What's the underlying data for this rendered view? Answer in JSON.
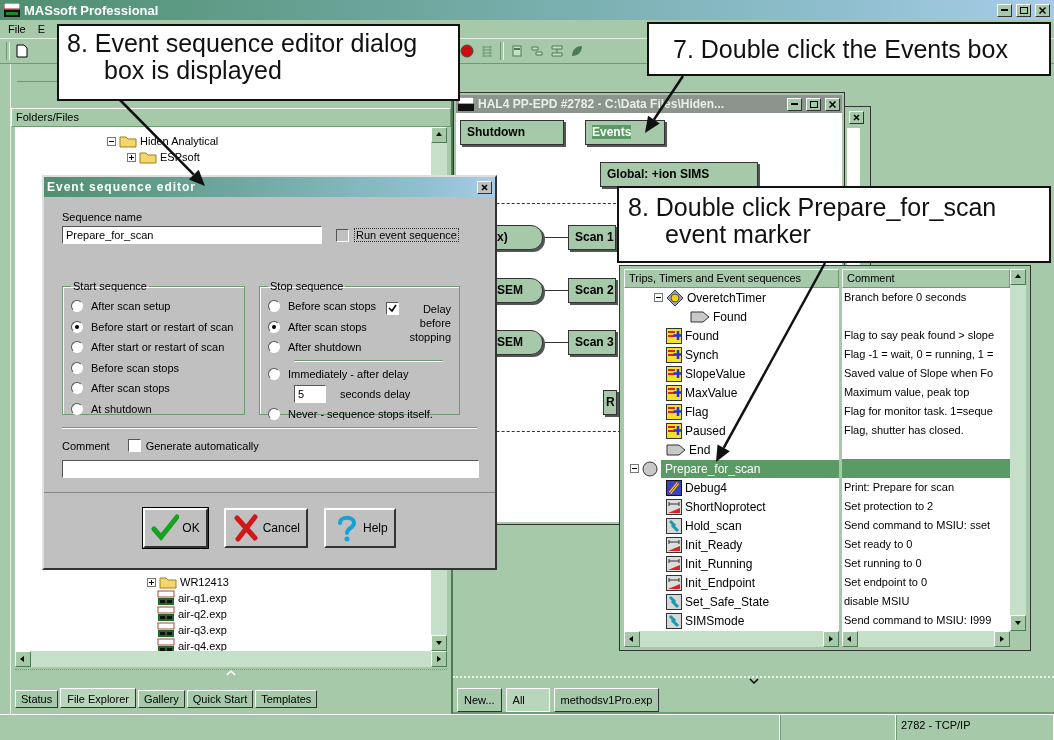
{
  "window": {
    "title": "MASsoft Professional"
  },
  "menu": [
    "File",
    "E"
  ],
  "explorer": {
    "header": "Folders/Files",
    "tree_top": [
      {
        "name": "Hiden Analytical",
        "kind": "folder",
        "expanded": true,
        "children": [
          {
            "name": "ESPsoft",
            "kind": "folder",
            "expanded": false
          }
        ]
      }
    ],
    "tree_bottom": [
      {
        "name": "WR12413",
        "kind": "folder",
        "expanded": false
      },
      {
        "name": "air-q1.exp",
        "kind": "file"
      },
      {
        "name": "air-q2.exp",
        "kind": "file"
      },
      {
        "name": "air-q3.exp",
        "kind": "file"
      },
      {
        "name": "air-q4.exp",
        "kind": "file"
      }
    ],
    "tabs": [
      {
        "label": "Status",
        "selected": false
      },
      {
        "label": "File Explorer",
        "selected": true
      },
      {
        "label": "Gallery",
        "selected": false
      },
      {
        "label": "Quick Start",
        "selected": false
      },
      {
        "label": "Templates",
        "selected": false
      }
    ]
  },
  "method_window": {
    "title": "HAL4 PP-EPD  #2782 - C:\\Data Files\\Hiden...",
    "nodes": [
      {
        "label": "Shutdown",
        "kind": "box",
        "selected": false
      },
      {
        "label": "Events",
        "kind": "box",
        "selected": true
      },
      {
        "label": "Global: +ion SIMS",
        "kind": "box",
        "selected": false
      },
      {
        "label": "x)",
        "kind": "rounded",
        "selected": false
      },
      {
        "label": "Scan 1",
        "kind": "box",
        "selected": false
      },
      {
        "label": "SEM",
        "kind": "rounded",
        "selected": false
      },
      {
        "label": "Scan 2",
        "kind": "box",
        "selected": false
      },
      {
        "label": "SEM",
        "kind": "rounded",
        "selected": false
      },
      {
        "label": "Scan 3",
        "kind": "box",
        "selected": false
      },
      {
        "label": "R",
        "kind": "box",
        "selected": false
      }
    ]
  },
  "trips": {
    "columns": [
      "Trips, Timers and Event sequences",
      "Comment"
    ],
    "partial_children": [
      {
        "name": "OveretchTimer",
        "kind": "timer",
        "comment": "Branch before  0 seconds",
        "selected": false,
        "expanded": true,
        "children": [
          {
            "name": "Found",
            "kind": "marker",
            "selected": false
          }
        ]
      },
      {
        "name": "Found",
        "kind": "variable",
        "comment": "Flag to say peak found > slope",
        "selected": false
      },
      {
        "name": "Synch",
        "kind": "variable",
        "comment": "Flag  -1 = wait, 0 = running, 1 =",
        "selected": false
      },
      {
        "name": "SlopeValue",
        "kind": "variable",
        "comment": "Saved value of Slope when Fo",
        "selected": false
      },
      {
        "name": "MaxValue",
        "kind": "variable",
        "comment": "Maximum value, peak top",
        "selected": false
      },
      {
        "name": "Flag",
        "kind": "variable",
        "comment": "Flag for monitor task. 1=seque",
        "selected": false
      },
      {
        "name": "Paused",
        "kind": "variable",
        "comment": "Flag, shutter has closed.",
        "selected": false
      },
      {
        "name": "End",
        "kind": "marker",
        "selected": false
      }
    ],
    "items": [
      {
        "name": "Prepare_for_scan",
        "kind": "sequence",
        "selected": true,
        "expanded": true,
        "children": [
          {
            "name": "Debug4",
            "kind": "print",
            "comment": "Print: Prepare for scan",
            "selected": false
          },
          {
            "name": "ShortNoprotect",
            "kind": "setting",
            "comment": "Set protection to 2",
            "selected": false
          },
          {
            "name": "Hold_scan",
            "kind": "command",
            "comment": "Send command to MSIU: sset",
            "selected": false
          },
          {
            "name": "Init_Ready",
            "kind": "setting",
            "comment": "Set ready to 0",
            "selected": false
          },
          {
            "name": "Init_Running",
            "kind": "setting",
            "comment": "Set running to 0",
            "selected": false
          },
          {
            "name": "Init_Endpoint",
            "kind": "setting",
            "comment": "Set endpoint to 0",
            "selected": false
          },
          {
            "name": "Set_Safe_State",
            "kind": "command",
            "comment": "disable MSIU",
            "selected": false
          },
          {
            "name": "SIMSmode",
            "kind": "command",
            "comment": "Send command to MSIU: I999",
            "selected": false
          }
        ]
      }
    ]
  },
  "dialog": {
    "title": "Event sequence editor",
    "name_label": "Sequence name",
    "name_value": "Prepare_for_scan",
    "run": {
      "label": "Run event sequence",
      "checked": false,
      "disabled": true
    },
    "start": {
      "legend": "Start sequence",
      "options": [
        {
          "label": "After scan setup",
          "selected": false
        },
        {
          "label": "Before start or restart of scan",
          "selected": true
        },
        {
          "label": "After start or restart of scan",
          "selected": false
        },
        {
          "label": "Before scan stops",
          "selected": false
        },
        {
          "label": "After scan stops",
          "selected": false
        },
        {
          "label": "At shutdown",
          "selected": false
        }
      ]
    },
    "stop": {
      "legend": "Stop sequence",
      "options": [
        {
          "label": "Before scan stops",
          "selected": false
        },
        {
          "label": "After scan stops",
          "selected": true
        },
        {
          "label": "After shutdown",
          "selected": false
        }
      ],
      "delay_check": {
        "label": "Delay before stopping",
        "checked": true
      },
      "immediate": {
        "label": "Immediately - after delay",
        "selected": false
      },
      "delay": {
        "value": "5",
        "unit": "seconds delay"
      },
      "never": {
        "label": "Never - sequence stops itself.",
        "selected": false
      }
    },
    "comment_label": "Comment",
    "generate": {
      "label": "Generate automatically",
      "checked": false
    },
    "buttons": [
      {
        "label": "OK",
        "kind": "ok",
        "default": true
      },
      {
        "label": "Cancel",
        "kind": "cancel",
        "default": false
      },
      {
        "label": "Help",
        "kind": "help",
        "default": false
      }
    ]
  },
  "document_tabs": [
    {
      "label": "New...",
      "selected": false
    },
    {
      "label": "All",
      "selected": true
    },
    {
      "label": "methodsv1Pro.exp",
      "selected": false
    }
  ],
  "status_bar": {
    "connection": "2782 - TCP/IP"
  },
  "callouts": [
    {
      "text": "8. Event sequence editor dialog box is displayed"
    },
    {
      "text": "7. Double click the Events box"
    },
    {
      "text": "8. Double click Prepare_for_scan event marker"
    }
  ]
}
